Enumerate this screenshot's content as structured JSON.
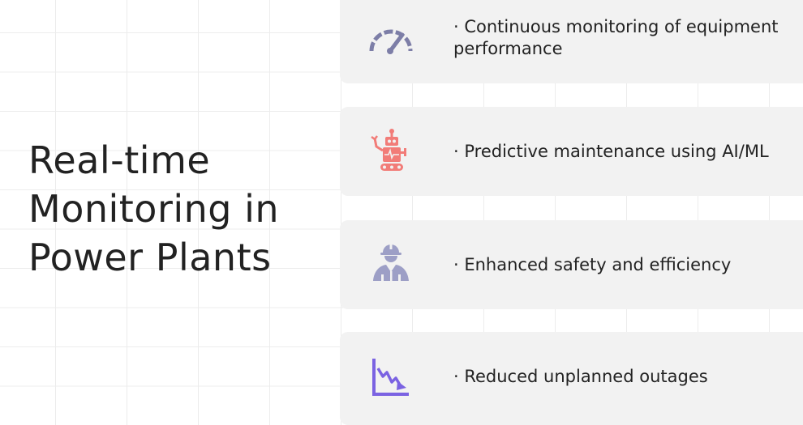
{
  "title": "Real-time Monitoring in Power Plants",
  "items": [
    {
      "text": "· Continuous monitoring of equipment performance",
      "icon": "gauge-icon",
      "color": "#7d7ea7"
    },
    {
      "text": "· Predictive maintenance using AI/ML",
      "icon": "robot-icon",
      "color": "#f27c78"
    },
    {
      "text": "· Enhanced safety and efficiency",
      "icon": "engineer-icon",
      "color": "#9d9fc6"
    },
    {
      "text": "· Reduced unplanned outages",
      "icon": "downtrend-chart-icon",
      "color": "#7b63e2"
    }
  ]
}
